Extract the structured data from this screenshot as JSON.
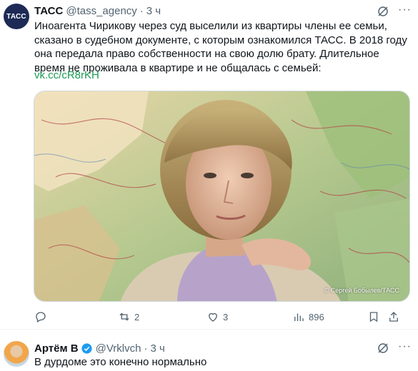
{
  "tweet": {
    "avatar_text": "ТАСС",
    "name": "ТАСС",
    "handle": "@tass_agency",
    "separator": "·",
    "time": "3 ч",
    "more": "···",
    "text": "Иноагента Чирикову через суд выселили из квартиры члены ее семьи, сказано в судебном документе, с которым ознакомился ТАСС. В 2018 году она передала право собственности на свою долю брату. Длительное время не проживала в квартире и не общалась с семьей:",
    "link": "vk.cc/cR8rKH",
    "photo_credit": "© Сергей Бобылев/ТАСС",
    "actions": {
      "reply_icon": "reply-icon",
      "retweets": "2",
      "likes": "3",
      "views": "896"
    }
  },
  "reply": {
    "name": "Артём В",
    "handle": "@Vrklvch",
    "separator": "·",
    "time": "3 ч",
    "more": "···",
    "text": "В дурдоме это конечно нормально"
  },
  "colors": {
    "text": "#0f1419",
    "muted": "#536471",
    "link": "#1d9b55",
    "verified": "#1d9bf0",
    "tass_avatar": "#1c2a55"
  }
}
